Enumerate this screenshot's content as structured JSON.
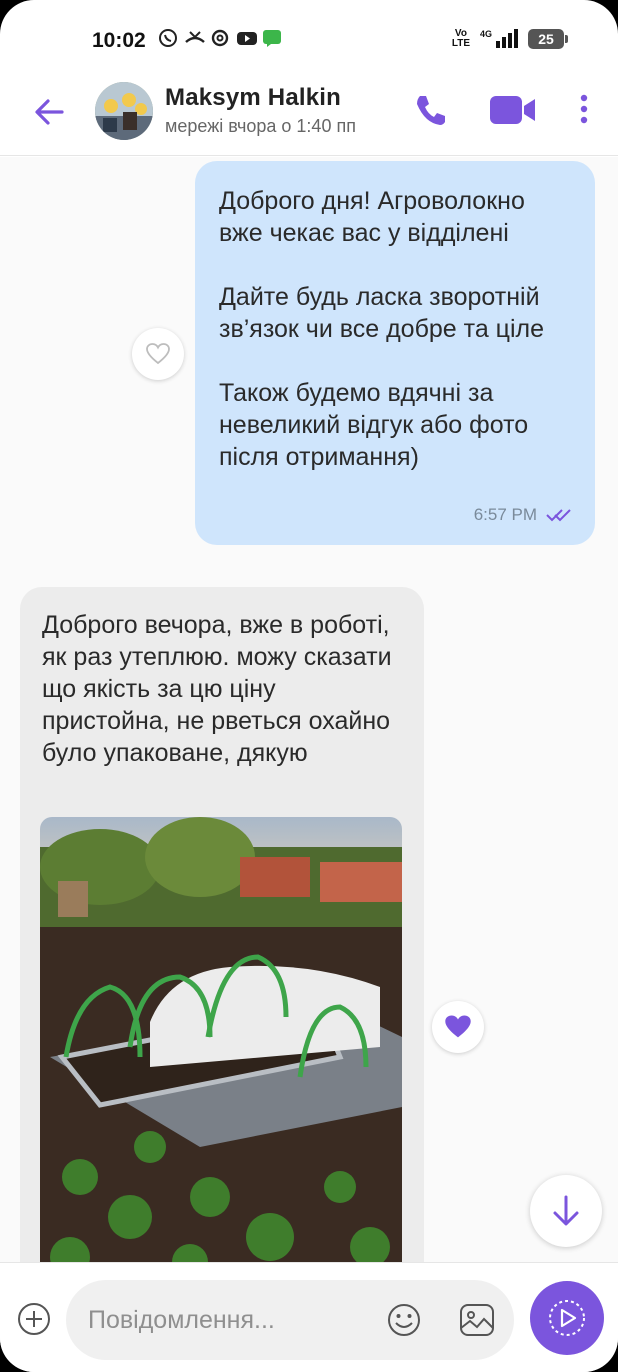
{
  "status_bar": {
    "time": "10:02",
    "network": "4G",
    "volte": "Vo LTE",
    "battery": "25",
    "icons": [
      "viber-icon",
      "missed-call-icon",
      "threads-icon",
      "youtube-icon",
      "messages-icon"
    ]
  },
  "header": {
    "contact_name": "Maksym Halkin",
    "last_seen": "мережі вчора о 1:40 пп",
    "accent_color": "#7b55dd"
  },
  "messages": [
    {
      "direction": "outgoing",
      "paragraphs": [
        "Доброго дня! Агроволокно вже чекає вас у відділені",
        "Дайте будь ласка зворотній зв’язок чи все добре та ціле",
        "Також будемо вдячні за невеликий відгук або фото після отримання)"
      ],
      "time": "6:57 PM",
      "status": "read",
      "liked": false
    },
    {
      "direction": "incoming",
      "text": "Доброго вечора, вже в роботі, як раз утеплюю. можу сказати що якість за цю ціну пристойна, не рветься охайно було упаковане, дякую",
      "has_photo": true,
      "photo_subject": "garden-greenhouse-photo",
      "liked": true
    }
  ],
  "composer": {
    "placeholder": "Повідомлення..."
  },
  "colors": {
    "outgoing_bubble": "#cfe5fc",
    "incoming_bubble": "#ececec",
    "accent": "#7b55dd"
  }
}
